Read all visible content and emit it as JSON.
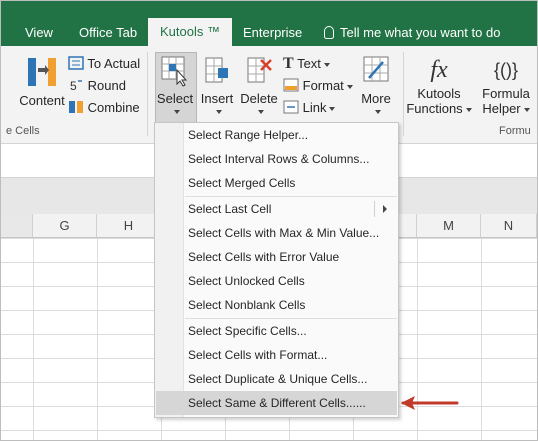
{
  "tabs": [
    {
      "label": "View"
    },
    {
      "label": "Office Tab"
    },
    {
      "label": "Kutools ™"
    },
    {
      "label": "Enterprise"
    }
  ],
  "tell_me": "Tell me what you want to do",
  "ribbon": {
    "content": "Content",
    "to_actual": "To Actual",
    "round": "Round",
    "combine": "Combine",
    "select": "Select",
    "insert": "Insert",
    "delete": "Delete",
    "text": "Text",
    "format": "Format",
    "link": "Link",
    "more": "More",
    "kutools_functions_1": "Kutools",
    "kutools_functions_2": "Functions",
    "formula_helper_1": "Formula",
    "formula_helper_2": "Helper",
    "group_cells": "e Cells",
    "group_formula": "Formu"
  },
  "columns": [
    "G",
    "H",
    "",
    "",
    "",
    "",
    "M",
    "N"
  ],
  "menu": {
    "items": [
      {
        "label": "Select Range Helper..."
      },
      {
        "label": "Select Interval Rows & Columns..."
      },
      {
        "label": "Select Merged Cells"
      },
      {
        "label": "Select Last Cell"
      },
      {
        "label": "Select Cells with Max & Min Value..."
      },
      {
        "label": "Select Cells with Error Value"
      },
      {
        "label": "Select Unlocked Cells"
      },
      {
        "label": "Select Nonblank Cells"
      },
      {
        "label": "Select Specific Cells..."
      },
      {
        "label": "Select Cells with Format..."
      },
      {
        "label": "Select Duplicate & Unique Cells..."
      },
      {
        "label": "Select Same & Different Cells......"
      }
    ]
  },
  "colors": {
    "excel_green": "#217346",
    "annotation_arrow": "#c0392b",
    "highlight": "#d6d6d6"
  }
}
